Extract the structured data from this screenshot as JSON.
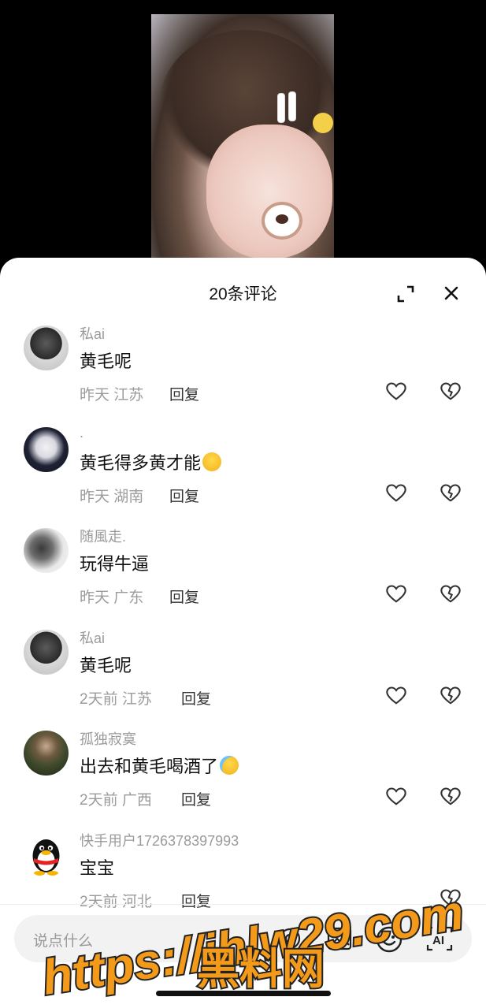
{
  "video": {
    "icon": "video-preview"
  },
  "sheet": {
    "title": "20条评论",
    "expand_icon": "expand-icon",
    "close_icon": "close-icon"
  },
  "comments": [
    {
      "user": "私ai",
      "text": "黄毛呢",
      "emoji": "",
      "time": "昨天",
      "location": "江苏",
      "reply": "回复",
      "avatar": "dark-hair-avatar"
    },
    {
      "user": ".",
      "text": "黄毛得多黄才能",
      "emoji": "smirk-emoji",
      "time": "昨天",
      "location": "湖南",
      "reply": "回复",
      "avatar": "anime-avatar"
    },
    {
      "user": "随風走.",
      "text": "玩得牛逼",
      "emoji": "",
      "time": "昨天",
      "location": "广东",
      "reply": "回复",
      "avatar": "grey-portrait-avatar"
    },
    {
      "user": "私ai",
      "text": "黄毛呢",
      "emoji": "",
      "time": "2天前",
      "location": "江苏",
      "reply": "回复",
      "avatar": "dark-hair-avatar"
    },
    {
      "user": "孤独寂寞",
      "text": "出去和黄毛喝酒了",
      "emoji": "crying-laughing-emoji",
      "time": "2天前",
      "location": "广西",
      "reply": "回复",
      "avatar": "soldier-avatar"
    },
    {
      "user": "快手用户1726378397993",
      "text": "宝宝",
      "emoji": "",
      "time": "2天前",
      "location": "河北",
      "reply": "回复",
      "avatar": "penguin-avatar"
    }
  ],
  "input": {
    "placeholder": "说点什么",
    "icons": [
      "at-icon",
      "image-icon",
      "emoji-icon",
      "ai-icon"
    ]
  },
  "watermark": {
    "url": "https://ihlw29.com",
    "name": "黑料网"
  },
  "colors": {
    "accent_orange": "#f39a1a",
    "muted": "#9b9b9b"
  }
}
